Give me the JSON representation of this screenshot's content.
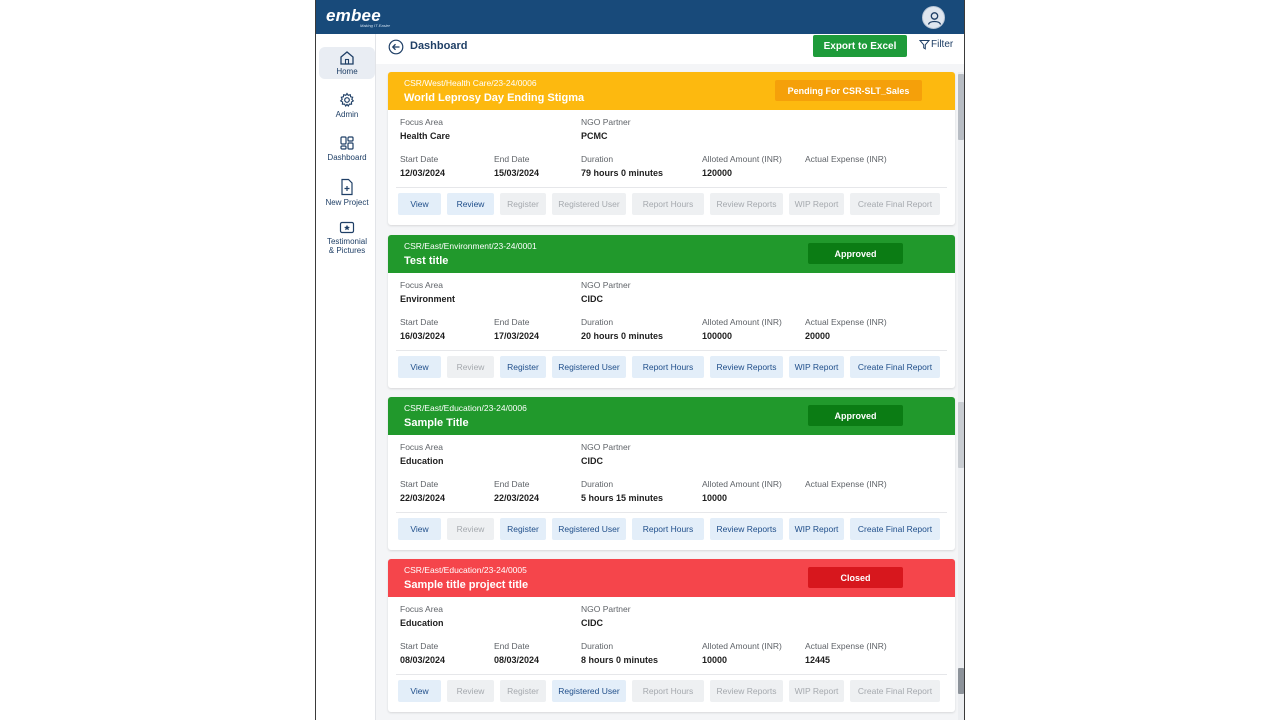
{
  "brand": {
    "logo": "embee",
    "tagline": "Making IT Easier"
  },
  "sidebar": {
    "items": [
      {
        "label": "Home",
        "icon": "home-icon",
        "active": true
      },
      {
        "label": "Admin",
        "icon": "gear-icon",
        "active": false
      },
      {
        "label": "Dashboard",
        "icon": "dashboard-icon",
        "active": false
      },
      {
        "label": "New Project",
        "icon": "file-plus-icon",
        "active": false
      },
      {
        "label_line1": "Testimonial",
        "label_line2": "& Pictures",
        "icon": "star-card-icon",
        "active": false
      }
    ]
  },
  "header": {
    "title": "Dashboard",
    "export_label": "Export to Excel",
    "filter_label": "Filter"
  },
  "labels": {
    "focus_area": "Focus Area",
    "ngo_partner": "NGO Partner",
    "start_date": "Start Date",
    "end_date": "End Date",
    "duration": "Duration",
    "alloted_amount": "Alloted Amount (INR)",
    "actual_expense": "Actual Expense (INR)"
  },
  "actions": [
    "View",
    "Review",
    "Register",
    "Registered User",
    "Report Hours",
    "Review Reports",
    "WIP Report",
    "Create Final Report"
  ],
  "colors": {
    "pending": "#fdb90f",
    "pending_badge": "#f5a00a",
    "approved": "#21992c",
    "approved_badge": "#0b7c14",
    "closed": "#f5454b",
    "closed_badge": "#d7171d",
    "accent": "#184a7a"
  },
  "projects": [
    {
      "code": "CSR/West/Health Care/23-24/0006",
      "title": "World Leprosy Day Ending Stigma",
      "status": "Pending For CSR-SLT_Sales",
      "status_type": "pending",
      "focus_area": "Health Care",
      "ngo_partner": "PCMC",
      "start_date": "12/03/2024",
      "end_date": "15/03/2024",
      "duration": "79 hours 0 minutes",
      "alloted_amount": "120000",
      "actual_expense": "",
      "enabled": [
        true,
        true,
        false,
        false,
        false,
        false,
        false,
        false
      ]
    },
    {
      "code": "CSR/East/Environment/23-24/0001",
      "title": "Test title",
      "status": "Approved",
      "status_type": "approved",
      "focus_area": "Environment",
      "ngo_partner": "CIDC",
      "start_date": "16/03/2024",
      "end_date": "17/03/2024",
      "duration": "20 hours 0 minutes",
      "alloted_amount": "100000",
      "actual_expense": "20000",
      "enabled": [
        true,
        false,
        true,
        true,
        true,
        true,
        true,
        true
      ]
    },
    {
      "code": "CSR/East/Education/23-24/0006",
      "title": "Sample Title",
      "status": "Approved",
      "status_type": "approved",
      "focus_area": "Education",
      "ngo_partner": "CIDC",
      "start_date": "22/03/2024",
      "end_date": "22/03/2024",
      "duration": "5 hours 15 minutes",
      "alloted_amount": "10000",
      "actual_expense": "",
      "enabled": [
        true,
        false,
        true,
        true,
        true,
        true,
        true,
        true
      ]
    },
    {
      "code": "CSR/East/Education/23-24/0005",
      "title": "Sample title project title",
      "status": "Closed",
      "status_type": "closed",
      "focus_area": "Education",
      "ngo_partner": "CIDC",
      "start_date": "08/03/2024",
      "end_date": "08/03/2024",
      "duration": "8 hours 0 minutes",
      "alloted_amount": "10000",
      "actual_expense": "12445",
      "enabled": [
        true,
        false,
        false,
        true,
        false,
        false,
        false,
        false
      ]
    }
  ]
}
